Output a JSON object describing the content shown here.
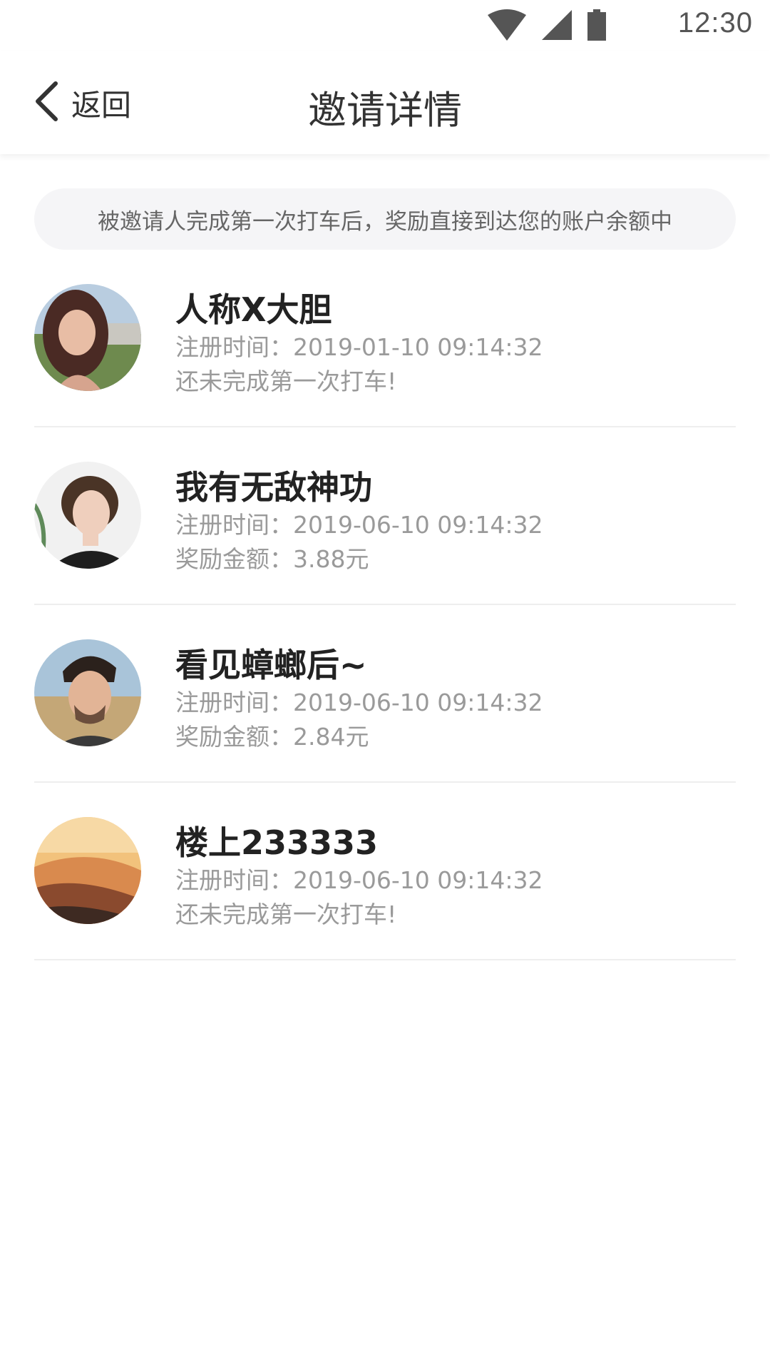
{
  "status_bar": {
    "time": "12:30",
    "icons": [
      "wifi-icon",
      "cellular-signal-icon",
      "battery-icon"
    ]
  },
  "nav": {
    "back_label": "返回",
    "title": "邀请详情"
  },
  "notice": {
    "text": "被邀请人完成第一次打车后，奖励直接到达您的账户余额中"
  },
  "invitees": [
    {
      "name": "人称X大胆",
      "reg_time": "注册时间：2019-01-10 09:14:32",
      "status": "还未完成第一次打车!"
    },
    {
      "name": "我有无敌神功",
      "reg_time": "注册时间：2019-06-10 09:14:32",
      "status": "奖励金额：3.88元"
    },
    {
      "name": "看见蟑螂后~",
      "reg_time": "注册时间：2019-06-10 09:14:32",
      "status": "奖励金额：2.84元"
    },
    {
      "name": "楼上233333",
      "reg_time": "注册时间：2019-06-10 09:14:32",
      "status": "还未完成第一次打车!"
    }
  ],
  "colors": {
    "title_text": "#333333",
    "secondary_text": "#9a9a9a",
    "notice_bg": "#f5f5f7",
    "divider": "#eeeeee"
  }
}
